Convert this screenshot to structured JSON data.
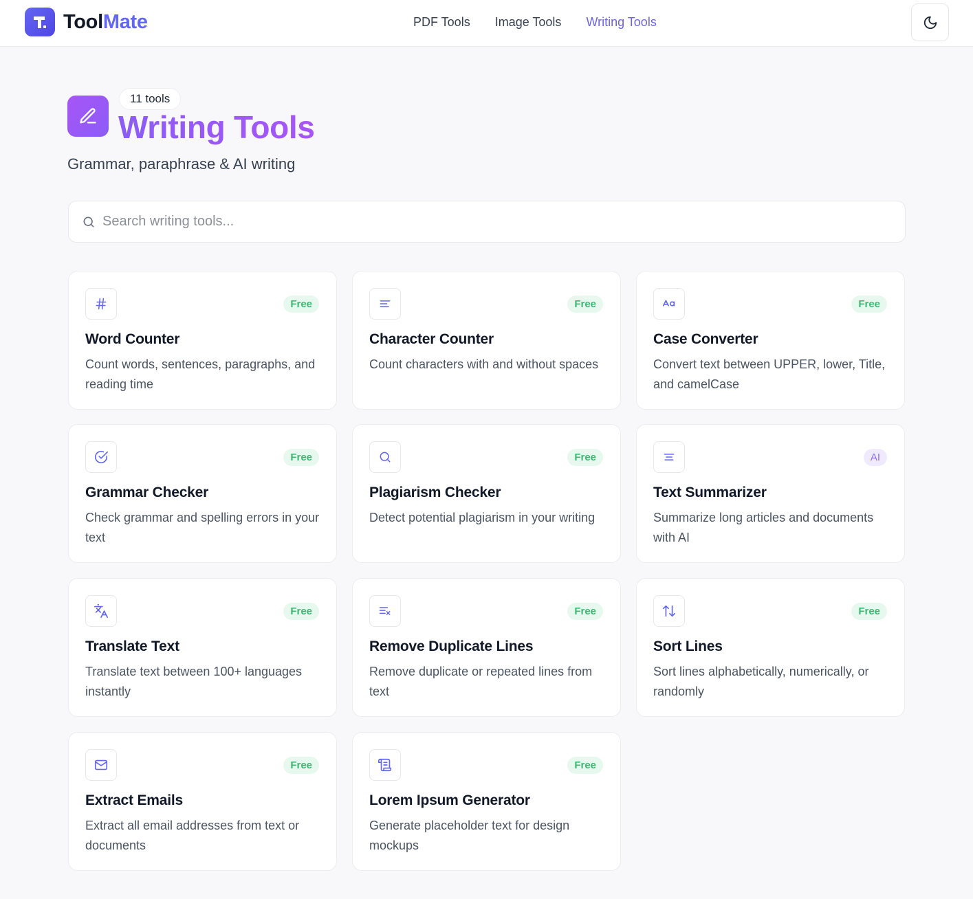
{
  "brand": {
    "name_part1": "Tool",
    "name_part2": "Mate"
  },
  "nav": [
    {
      "label": "PDF Tools",
      "active": false
    },
    {
      "label": "Image Tools",
      "active": false
    },
    {
      "label": "Writing Tools",
      "active": true
    }
  ],
  "header": {
    "theme_toggle_icon": "moon-icon"
  },
  "hero": {
    "icon": "pencil-icon",
    "count_label": "11 tools",
    "title": "Writing Tools",
    "subtitle": "Grammar, paraphrase & AI writing"
  },
  "search": {
    "placeholder": "Search writing tools...",
    "value": ""
  },
  "colors": {
    "accent": "#6366f1",
    "free_badge": "#3cb872",
    "ai_badge": "#8b6cf0",
    "title_gradient": "#8b5cf6"
  },
  "tools": [
    {
      "title": "Word Counter",
      "description": "Count words, sentences, paragraphs, and reading time",
      "badge": "Free",
      "icon": "hash-icon"
    },
    {
      "title": "Character Counter",
      "description": "Count characters with and without spaces",
      "badge": "Free",
      "icon": "align-left-icon"
    },
    {
      "title": "Case Converter",
      "description": "Convert text between UPPER, lower, Title, and camelCase",
      "badge": "Free",
      "icon": "case-sensitive-icon"
    },
    {
      "title": "Grammar Checker",
      "description": "Check grammar and spelling errors in your text",
      "badge": "Free",
      "icon": "check-circle-icon"
    },
    {
      "title": "Plagiarism Checker",
      "description": "Detect potential plagiarism in your writing",
      "badge": "Free",
      "icon": "search-icon"
    },
    {
      "title": "Text Summarizer",
      "description": "Summarize long articles and documents with AI",
      "badge": "AI",
      "icon": "align-center-icon"
    },
    {
      "title": "Translate Text",
      "description": "Translate text between 100+ languages instantly",
      "badge": "Free",
      "icon": "languages-icon"
    },
    {
      "title": "Remove Duplicate Lines",
      "description": "Remove duplicate or repeated lines from text",
      "badge": "Free",
      "icon": "list-x-icon"
    },
    {
      "title": "Sort Lines",
      "description": "Sort lines alphabetically, numerically, or randomly",
      "badge": "Free",
      "icon": "arrow-up-down-icon"
    },
    {
      "title": "Extract Emails",
      "description": "Extract all email addresses from text or documents",
      "badge": "Free",
      "icon": "mail-icon"
    },
    {
      "title": "Lorem Ipsum Generator",
      "description": "Generate placeholder text for design mockups",
      "badge": "Free",
      "icon": "scroll-text-icon"
    }
  ]
}
